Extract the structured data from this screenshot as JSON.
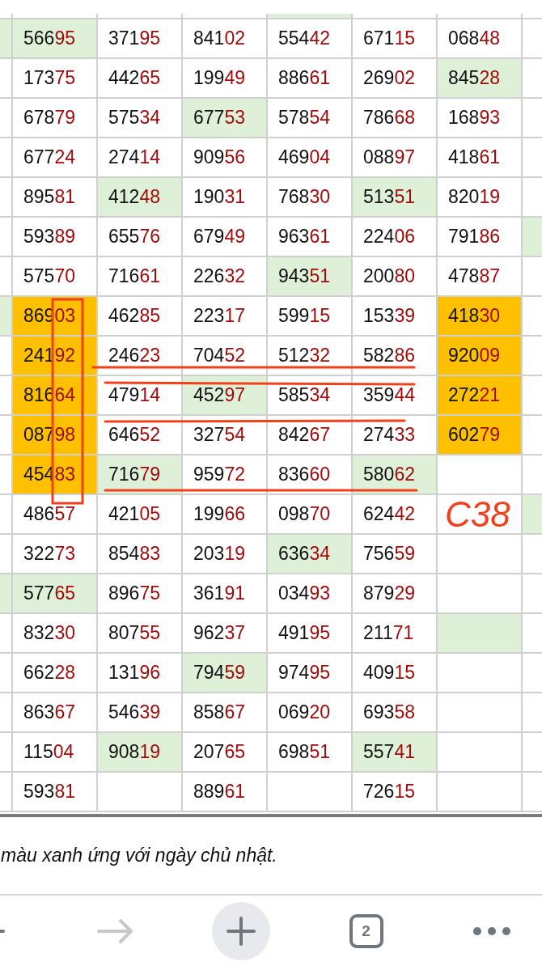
{
  "partial_row": {
    "cells": [
      {},
      {},
      {},
      {},
      {
        "color": "#dff0d8"
      },
      {},
      {},
      {}
    ]
  },
  "rows": [
    {
      "left_edge": {
        "color": "#dff0d8"
      },
      "cells": [
        {
          "value": "56695",
          "color": "#dff0d8"
        },
        {
          "value": "37195"
        },
        {
          "value": "84102"
        },
        {
          "value": "55442"
        },
        {
          "value": "67115"
        },
        {
          "value": "06848"
        }
      ],
      "right_edge": {}
    },
    {
      "left_edge": {},
      "cells": [
        {
          "value": "17375"
        },
        {
          "value": "44265"
        },
        {
          "value": "19949"
        },
        {
          "value": "88661"
        },
        {
          "value": "26902"
        },
        {
          "value": "84528",
          "color": "#dff0d8"
        }
      ],
      "right_edge": {}
    },
    {
      "left_edge": {},
      "cells": [
        {
          "value": "67879"
        },
        {
          "value": "57534"
        },
        {
          "value": "67753",
          "color": "#dff0d8"
        },
        {
          "value": "57854"
        },
        {
          "value": "78668"
        },
        {
          "value": "16893"
        }
      ],
      "right_edge": {}
    },
    {
      "left_edge": {},
      "cells": [
        {
          "value": "67724"
        },
        {
          "value": "27414"
        },
        {
          "value": "90956"
        },
        {
          "value": "46904"
        },
        {
          "value": "08897"
        },
        {
          "value": "41861"
        }
      ],
      "right_edge": {}
    },
    {
      "left_edge": {},
      "cells": [
        {
          "value": "89581"
        },
        {
          "value": "41248",
          "color": "#dff0d8"
        },
        {
          "value": "19031"
        },
        {
          "value": "76830"
        },
        {
          "value": "51351",
          "color": "#dff0d8"
        },
        {
          "value": "82019"
        }
      ],
      "right_edge": {}
    },
    {
      "left_edge": {},
      "cells": [
        {
          "value": "59389"
        },
        {
          "value": "65576"
        },
        {
          "value": "67949"
        },
        {
          "value": "96361"
        },
        {
          "value": "22406"
        },
        {
          "value": "79186"
        }
      ],
      "right_edge": {
        "color": "#dff0d8"
      }
    },
    {
      "left_edge": {},
      "cells": [
        {
          "value": "57570"
        },
        {
          "value": "71661"
        },
        {
          "value": "22632"
        },
        {
          "value": "94351",
          "color": "#dff0d8"
        },
        {
          "value": "20080"
        },
        {
          "value": "47887"
        }
      ],
      "right_edge": {}
    },
    {
      "left_edge": {
        "color": "#dff0d8"
      },
      "cells": [
        {
          "value": "86903",
          "color": "#ffc000"
        },
        {
          "value": "46285"
        },
        {
          "value": "22317"
        },
        {
          "value": "59915"
        },
        {
          "value": "15339"
        },
        {
          "value": "41830",
          "color": "#ffc000"
        }
      ],
      "right_edge": {}
    },
    {
      "left_edge": {},
      "cells": [
        {
          "value": "24192",
          "color": "#ffc000"
        },
        {
          "value": "24623"
        },
        {
          "value": "70452"
        },
        {
          "value": "51232"
        },
        {
          "value": "58286"
        },
        {
          "value": "92009",
          "color": "#ffc000"
        }
      ],
      "right_edge": {}
    },
    {
      "left_edge": {},
      "cells": [
        {
          "value": "81664",
          "color": "#ffc000"
        },
        {
          "value": "47914"
        },
        {
          "value": "45297",
          "color": "#dff0d8"
        },
        {
          "value": "58534"
        },
        {
          "value": "35944"
        },
        {
          "value": "27221",
          "color": "#ffc000"
        }
      ],
      "right_edge": {}
    },
    {
      "left_edge": {},
      "cells": [
        {
          "value": "08798",
          "color": "#ffc000"
        },
        {
          "value": "64652"
        },
        {
          "value": "32754"
        },
        {
          "value": "84267"
        },
        {
          "value": "27433"
        },
        {
          "value": "60279",
          "color": "#ffc000"
        }
      ],
      "right_edge": {}
    },
    {
      "left_edge": {},
      "cells": [
        {
          "value": "45483",
          "color": "#ffc000"
        },
        {
          "value": "71679",
          "color": "#dff0d8"
        },
        {
          "value": "95972"
        },
        {
          "value": "83660"
        },
        {
          "value": "58062",
          "color": "#dff0d8"
        },
        {}
      ],
      "right_edge": {}
    },
    {
      "left_edge": {},
      "cells": [
        {
          "value": "48657"
        },
        {
          "value": "42105"
        },
        {
          "value": "19966"
        },
        {
          "value": "09870"
        },
        {
          "value": "62442"
        },
        {}
      ],
      "right_edge": {
        "color": "#dff0d8"
      }
    },
    {
      "left_edge": {},
      "cells": [
        {
          "value": "32273"
        },
        {
          "value": "85483"
        },
        {
          "value": "20319"
        },
        {
          "value": "63634",
          "color": "#dff0d8"
        },
        {
          "value": "75659"
        },
        {}
      ],
      "right_edge": {}
    },
    {
      "left_edge": {
        "color": "#dff0d8"
      },
      "cells": [
        {
          "value": "57765",
          "color": "#dff0d8"
        },
        {
          "value": "89675"
        },
        {
          "value": "36191"
        },
        {
          "value": "03493"
        },
        {
          "value": "87929"
        },
        {}
      ],
      "right_edge": {}
    },
    {
      "left_edge": {},
      "cells": [
        {
          "value": "83230"
        },
        {
          "value": "80755"
        },
        {
          "value": "96237"
        },
        {
          "value": "49195"
        },
        {
          "value": "21171"
        },
        {
          "color": "#dff0d8"
        }
      ],
      "right_edge": {}
    },
    {
      "left_edge": {},
      "cells": [
        {
          "value": "66228"
        },
        {
          "value": "13196"
        },
        {
          "value": "79459",
          "color": "#dff0d8"
        },
        {
          "value": "97495"
        },
        {
          "value": "40915"
        },
        {}
      ],
      "right_edge": {}
    },
    {
      "left_edge": {},
      "cells": [
        {
          "value": "86367"
        },
        {
          "value": "54639"
        },
        {
          "value": "85867"
        },
        {
          "value": "06920"
        },
        {
          "value": "69358"
        },
        {}
      ],
      "right_edge": {}
    },
    {
      "left_edge": {},
      "cells": [
        {
          "value": "11504"
        },
        {
          "value": "90819",
          "color": "#dff0d8"
        },
        {
          "value": "20765"
        },
        {
          "value": "69851"
        },
        {
          "value": "55741",
          "color": "#dff0d8"
        },
        {}
      ],
      "right_edge": {}
    },
    {
      "left_edge": {},
      "cells": [
        {
          "value": "59381"
        },
        {},
        {
          "value": "88961"
        },
        {},
        {
          "value": "72615"
        },
        {}
      ],
      "right_edge": {}
    }
  ],
  "annotation": {
    "text": "C38"
  },
  "caption": "màu xanh ứng với ngày chủ nhật.",
  "toolbar": {
    "tab_count": "2"
  }
}
